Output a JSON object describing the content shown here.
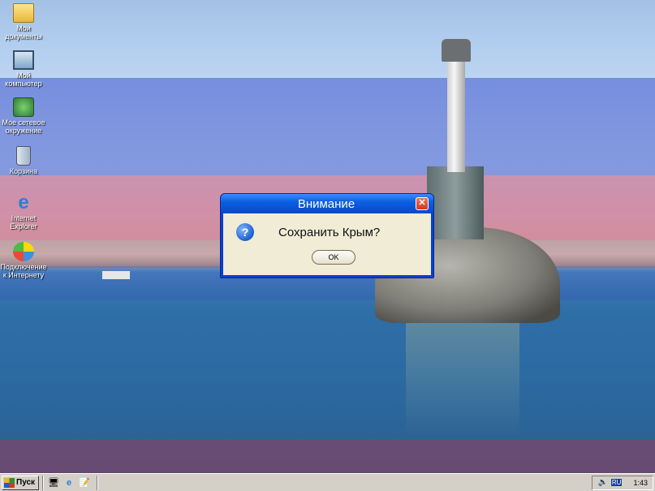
{
  "desktop": {
    "icons": [
      {
        "label": "Мои документы",
        "icon": "my-documents-icon"
      },
      {
        "label": "Мой компьютер",
        "icon": "my-computer-icon"
      },
      {
        "label": "Мое сетевое окружение",
        "icon": "network-places-icon"
      },
      {
        "label": "Корзина",
        "icon": "recycle-bin-icon"
      },
      {
        "label": "Internet Explorer",
        "icon": "internet-explorer-icon"
      },
      {
        "label": "Подключение к Интернету",
        "icon": "internet-connection-icon"
      }
    ]
  },
  "dialog": {
    "title": "Внимание",
    "close": "✕",
    "message": "Сохранить Крым?",
    "ok_label": "OK"
  },
  "taskbar": {
    "start_label": "Пуск",
    "language": "RU",
    "clock": "1:43"
  }
}
